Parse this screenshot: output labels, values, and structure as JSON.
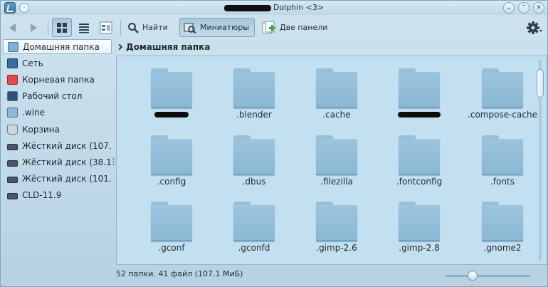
{
  "window": {
    "title_suffix": "Dolphin <3>",
    "pin_glyph": "·",
    "buttons": {
      "minimize": "⌄",
      "maximize": "⌃",
      "close": "✕"
    }
  },
  "toolbar": {
    "find_label": "Найти",
    "preview_label": "Миниатюры",
    "split_label": "Две панели"
  },
  "places": [
    {
      "label": "Домашняя папка",
      "icon": "home-icon",
      "color": "#7fb0d8",
      "selected": true
    },
    {
      "label": "Сеть",
      "icon": "network-icon",
      "color": "#3a6ea0",
      "selected": false
    },
    {
      "label": "Корневая папка",
      "icon": "root-folder-icon",
      "color": "#e04b4b",
      "selected": false
    },
    {
      "label": "Рабочий стол",
      "icon": "desktop-icon",
      "color": "#2d4f7a",
      "selected": false
    },
    {
      "label": ".wine",
      "icon": "folder-icon",
      "color": "#8cb9d6",
      "selected": false
    },
    {
      "label": "Корзина",
      "icon": "trash-icon",
      "color": "#cfd7dc",
      "selected": false
    },
    {
      "label": "Жёсткий диск (107....",
      "icon": "harddisk-icon",
      "color": "#4a5660",
      "selected": false
    },
    {
      "label": "Жёсткий диск (38.1...",
      "icon": "harddisk-icon",
      "color": "#4a5660",
      "selected": false
    },
    {
      "label": "Жёсткий диск (101....",
      "icon": "harddisk-icon",
      "color": "#4a5660",
      "selected": false
    },
    {
      "label": "CLD-11.9",
      "icon": "harddisk-icon",
      "color": "#4a5660",
      "selected": false
    }
  ],
  "breadcrumb": {
    "current": "Домашняя папка"
  },
  "files": [
    {
      "name": "",
      "redacted": true
    },
    {
      "name": ".blender",
      "redacted": false
    },
    {
      "name": ".cache",
      "redacted": false
    },
    {
      "name": "",
      "redacted": true
    },
    {
      "name": ".compose-cache",
      "redacted": false
    },
    {
      "name": ".config",
      "redacted": false
    },
    {
      "name": ".dbus",
      "redacted": false
    },
    {
      "name": ".filezilla",
      "redacted": false
    },
    {
      "name": ".fontconfig",
      "redacted": false
    },
    {
      "name": ".fonts",
      "redacted": false
    },
    {
      "name": ".gconf",
      "redacted": false
    },
    {
      "name": ".gconfd",
      "redacted": false
    },
    {
      "name": ".gimp-2.6",
      "redacted": false
    },
    {
      "name": ".gimp-2.8",
      "redacted": false
    },
    {
      "name": ".gnome2",
      "redacted": false
    }
  ],
  "status": {
    "text": "52 папки. 41 файл (107.1 МиБ)",
    "zoom_fraction": 0.3
  },
  "colors": {
    "accent": "#7fa6bd",
    "view_background": "#c3e0f1",
    "folder": "#9cc4dd"
  }
}
